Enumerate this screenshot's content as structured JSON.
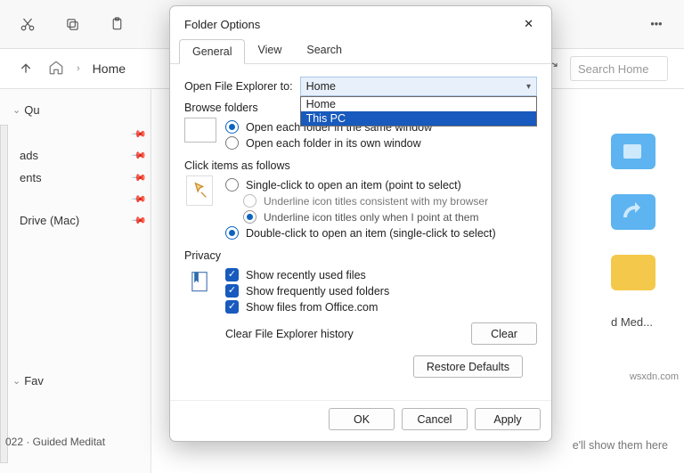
{
  "toolbar": {
    "more": "•••"
  },
  "nav": {
    "crumb": "Home",
    "search_placeholder": "Search Home"
  },
  "sidebar": {
    "group1": "Qu",
    "items": [
      "",
      "ads",
      "ents",
      "",
      "Drive (Mac)"
    ],
    "group2": "Fav"
  },
  "footer": {
    "left": "022 · Guided Meditat",
    "right_label": "d Med...",
    "right_caption": "e'll show them here"
  },
  "watermark": "wsxdn.com",
  "dialog": {
    "title": "Folder Options",
    "tabs": [
      "General",
      "View",
      "Search"
    ],
    "open_label": "Open File Explorer to:",
    "combo_value": "Home",
    "dropdown": [
      "Home",
      "This PC"
    ],
    "browse": {
      "title": "Browse folders",
      "opt_same": "Open each folder in the same window",
      "opt_own": "Open each folder in its own window"
    },
    "click": {
      "title": "Click items as follows",
      "single": "Single-click to open an item (point to select)",
      "u1": "Underline icon titles consistent with my browser",
      "u2": "Underline icon titles only when I point at them",
      "double": "Double-click to open an item (single-click to select)"
    },
    "privacy": {
      "title": "Privacy",
      "c1": "Show recently used files",
      "c2": "Show frequently used folders",
      "c3": "Show files from Office.com",
      "clear_label": "Clear File Explorer history",
      "clear_btn": "Clear"
    },
    "restore": "Restore Defaults",
    "ok": "OK",
    "cancel": "Cancel",
    "apply": "Apply"
  }
}
